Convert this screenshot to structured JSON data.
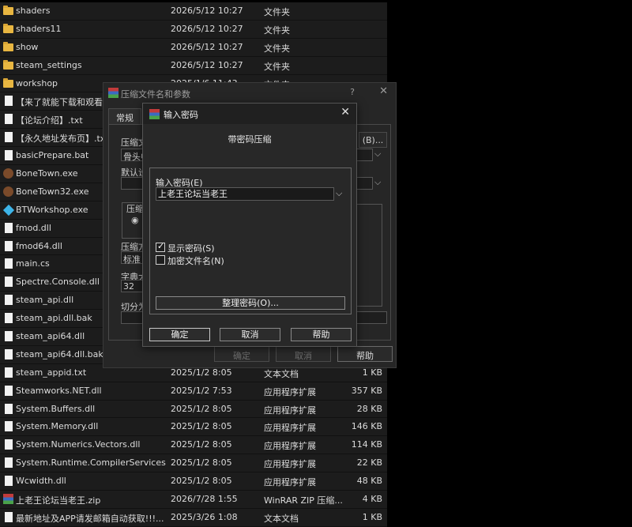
{
  "files": [
    {
      "name": "shaders",
      "date": "2026/5/12 10:27",
      "type": "文件夹",
      "size": "",
      "icon": "folder-icon"
    },
    {
      "name": "shaders11",
      "date": "2026/5/12 10:27",
      "type": "文件夹",
      "size": "",
      "icon": "folder-icon"
    },
    {
      "name": "show",
      "date": "2026/5/12 10:27",
      "type": "文件夹",
      "size": "",
      "icon": "folder-icon"
    },
    {
      "name": "steam_settings",
      "date": "2026/5/12 10:27",
      "type": "文件夹",
      "size": "",
      "icon": "folder-icon"
    },
    {
      "name": "workshop",
      "date": "2025/1/6 11:43",
      "type": "文件夹",
      "size": "",
      "icon": "folder-icon"
    },
    {
      "name": "【来了就能下载和观看!免",
      "date": "",
      "type": "",
      "size": "",
      "icon": "text-file-icon"
    },
    {
      "name": "【论坛介绍】.txt",
      "date": "",
      "type": "",
      "size": "",
      "icon": "text-file-icon"
    },
    {
      "name": "【永久地址发布页】.txt",
      "date": "",
      "type": "",
      "size": "",
      "icon": "text-file-icon"
    },
    {
      "name": "basicPrepare.bat",
      "date": "",
      "type": "",
      "size": "",
      "icon": "text-file-icon"
    },
    {
      "name": "BoneTown.exe",
      "date": "",
      "type": "",
      "size": "",
      "icon": "app-exe-icon"
    },
    {
      "name": "BoneTown32.exe",
      "date": "",
      "type": "",
      "size": "",
      "icon": "app-exe-icon"
    },
    {
      "name": "BTWorkshop.exe",
      "date": "",
      "type": "",
      "size": "",
      "icon": "workshop-exe-icon"
    },
    {
      "name": "fmod.dll",
      "date": "",
      "type": "",
      "size": "",
      "icon": "text-file-icon"
    },
    {
      "name": "fmod64.dll",
      "date": "",
      "type": "",
      "size": "",
      "icon": "text-file-icon"
    },
    {
      "name": "main.cs",
      "date": "",
      "type": "",
      "size": "",
      "icon": "text-file-icon"
    },
    {
      "name": "Spectre.Console.dll",
      "date": "",
      "type": "",
      "size": "",
      "icon": "text-file-icon"
    },
    {
      "name": "steam_api.dll",
      "date": "",
      "type": "",
      "size": "",
      "icon": "text-file-icon"
    },
    {
      "name": "steam_api.dll.bak",
      "date": "",
      "type": "",
      "size": "",
      "icon": "text-file-icon"
    },
    {
      "name": "steam_api64.dll",
      "date": "",
      "type": "",
      "size": "",
      "icon": "text-file-icon"
    },
    {
      "name": "steam_api64.dll.bak",
      "date": "",
      "type": "",
      "size": "",
      "icon": "text-file-icon"
    },
    {
      "name": "steam_appid.txt",
      "date": "2025/1/2 8:05",
      "type": "文本文档",
      "size": "1 KB",
      "icon": "text-file-icon"
    },
    {
      "name": "Steamworks.NET.dll",
      "date": "2025/1/2 7:53",
      "type": "应用程序扩展",
      "size": "357 KB",
      "icon": "text-file-icon"
    },
    {
      "name": "System.Buffers.dll",
      "date": "2025/1/2 8:05",
      "type": "应用程序扩展",
      "size": "28 KB",
      "icon": "text-file-icon"
    },
    {
      "name": "System.Memory.dll",
      "date": "2025/1/2 8:05",
      "type": "应用程序扩展",
      "size": "146 KB",
      "icon": "text-file-icon"
    },
    {
      "name": "System.Numerics.Vectors.dll",
      "date": "2025/1/2 8:05",
      "type": "应用程序扩展",
      "size": "114 KB",
      "icon": "text-file-icon"
    },
    {
      "name": "System.Runtime.CompilerServices.Un...",
      "date": "2025/1/2 8:05",
      "type": "应用程序扩展",
      "size": "22 KB",
      "icon": "text-file-icon"
    },
    {
      "name": "Wcwidth.dll",
      "date": "2025/1/2 8:05",
      "type": "应用程序扩展",
      "size": "48 KB",
      "icon": "text-file-icon"
    },
    {
      "name": "上老王论坛当老王.zip",
      "date": "2026/7/28 1:55",
      "type": "WinRAR ZIP 压缩...",
      "size": "4 KB",
      "icon": "winrar-zip-icon"
    },
    {
      "name": "最新地址及APP请发邮箱自动获取!!!...",
      "date": "2025/3/26 1:08",
      "type": "文本文档",
      "size": "1 KB",
      "icon": "text-file-icon"
    }
  ],
  "archive_dialog": {
    "title": "压缩文件名和参数",
    "help": "?",
    "close": "✕",
    "tab_general": "常规",
    "label_archive_name": "压缩文",
    "value_archive_name": "骨头中",
    "label_default": "默认设",
    "label_format": "压缩",
    "label_method": "压缩方",
    "value_method": "标准",
    "label_dict": "字典大",
    "value_dict": "32",
    "label_split": "切分为",
    "browse_label": "(B)...",
    "ok": "确定",
    "cancel": "取消",
    "help_btn": "帮助"
  },
  "password_dialog": {
    "title": "输入密码",
    "close": "✕",
    "subtitle": "带密码压缩",
    "password_label": "输入密码(E)",
    "password_value": "上老王论坛当老王",
    "show_password_label": "显示密码(S)",
    "show_password_checked": true,
    "encrypt_names_label": "加密文件名(N)",
    "encrypt_names_checked": false,
    "organize_button": "整理密码(O)...",
    "ok": "确定",
    "cancel": "取消",
    "help": "帮助"
  }
}
